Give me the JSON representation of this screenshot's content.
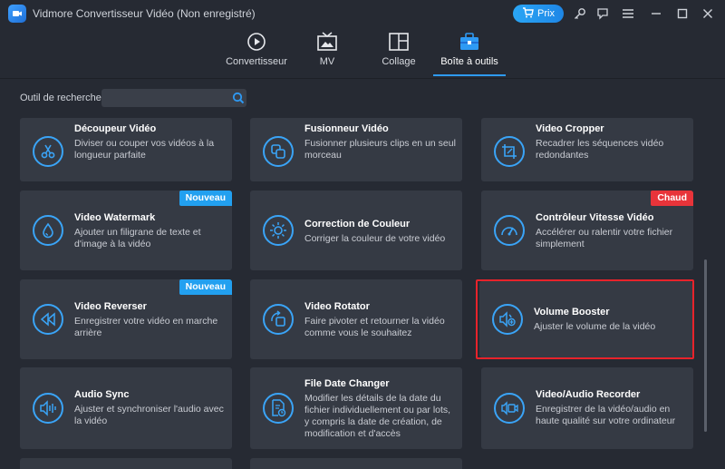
{
  "window": {
    "title": "Vidmore Convertisseur Vidéo (Non enregistré)",
    "buy_label": "Prix"
  },
  "nav": {
    "tabs": [
      {
        "label": "Convertisseur",
        "icon": "convert-icon"
      },
      {
        "label": "MV",
        "icon": "mv-icon"
      },
      {
        "label": "Collage",
        "icon": "collage-icon"
      },
      {
        "label": "Boîte à outils",
        "icon": "toolbox-icon",
        "active": true
      }
    ]
  },
  "search": {
    "label": "Outil de recherche :",
    "value": "",
    "placeholder": ""
  },
  "tools": [
    {
      "title": "Découpeur Vidéo",
      "desc": "Diviser ou couper vos vidéos à la longueur parfaite",
      "icon": "scissors-icon"
    },
    {
      "title": "Fusionneur Vidéo",
      "desc": "Fusionner plusieurs clips en un seul morceau",
      "icon": "merge-icon"
    },
    {
      "title": "Video Cropper",
      "desc": "Recadrer les séquences vidéo redondantes",
      "icon": "crop-icon"
    },
    {
      "title": "Video Watermark",
      "desc": "Ajouter un filigrane de texte et d'image à la vidéo",
      "icon": "drop-icon",
      "badge": "Nouveau"
    },
    {
      "title": "Correction de Couleur",
      "desc": "Corriger la couleur de votre vidéo",
      "icon": "sun-icon"
    },
    {
      "title": "Contrôleur Vitesse Vidéo",
      "desc": "Accélérer ou ralentir votre fichier simplement",
      "icon": "speedometer-icon",
      "badge": "Chaud"
    },
    {
      "title": "Video Reverser",
      "desc": "Enregistrer votre vidéo en marche arrière",
      "icon": "rewind-icon",
      "badge": "Nouveau"
    },
    {
      "title": "Video Rotator",
      "desc": "Faire pivoter et retourner la vidéo comme vous le souhaitez",
      "icon": "rotate-icon"
    },
    {
      "title": "Volume Booster",
      "desc": "Ajuster le volume de la vidéo",
      "icon": "volume-icon"
    },
    {
      "title": "Audio Sync",
      "desc": "Ajuster et synchroniser l'audio avec la vidéo",
      "icon": "audio-sync-icon"
    },
    {
      "title": "File Date Changer",
      "desc": "Modifier les détails de la date du fichier individuellement ou par lots, y compris la date de création, de modification et d'accès",
      "icon": "file-date-icon"
    },
    {
      "title": "Video/Audio Recorder",
      "desc": "Enregistrer de la vidéo/audio en haute qualité sur votre ordinateur",
      "icon": "recorder-icon"
    }
  ],
  "colors": {
    "accent": "#2e9af4",
    "badge_new": "#22a0f0",
    "badge_hot": "#e8343a",
    "highlight": "#e8232b"
  }
}
